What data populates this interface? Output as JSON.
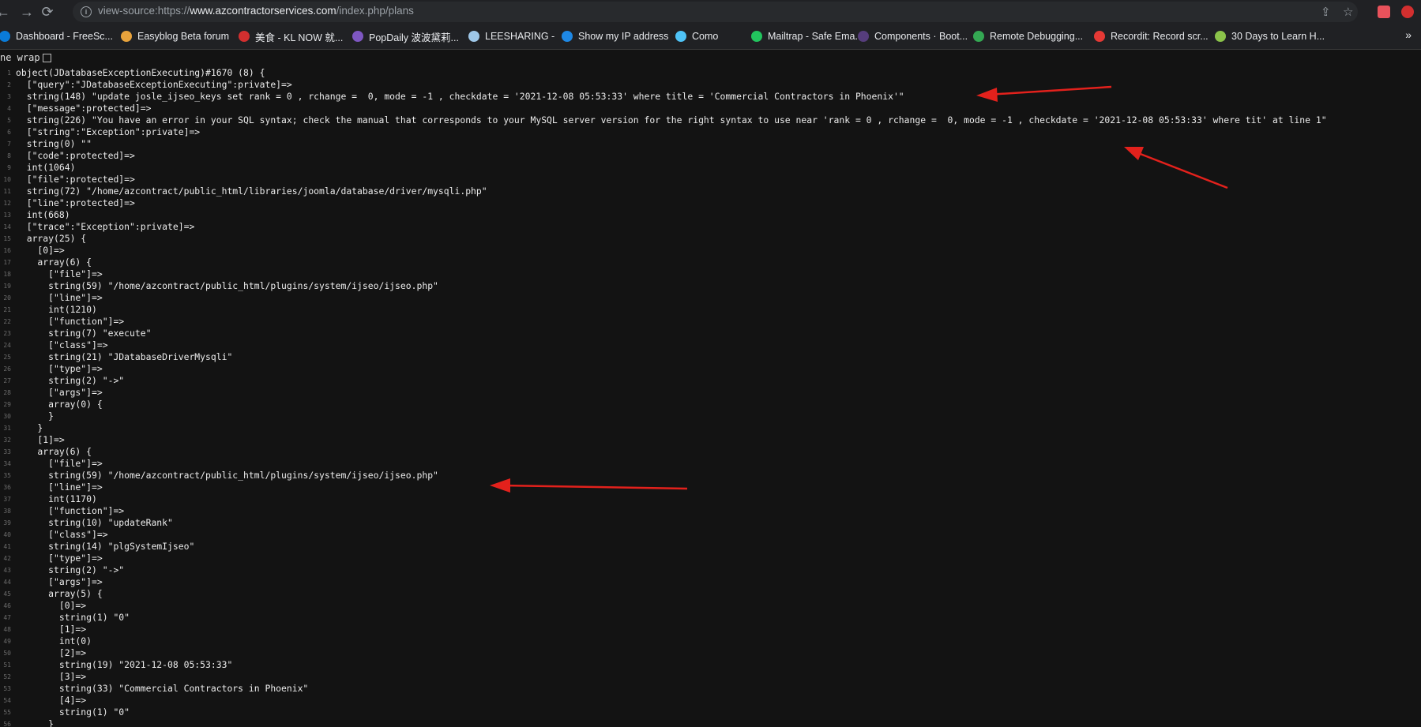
{
  "browser": {
    "url_prefix": "view-source:https://",
    "url_host": "www.azcontractorservices.com",
    "url_path": "/index.php/plans"
  },
  "bookmarks": [
    {
      "label": "Dashboard - FreeSc...",
      "color": "#0a7bd8"
    },
    {
      "label": "Easyblog Beta forum",
      "color": "#e8a33c"
    },
    {
      "label": "美食 - KL NOW 就...",
      "color": "#d32f2f"
    },
    {
      "label": "PopDaily 波波黛莉...",
      "color": "#7e57c2"
    },
    {
      "label": "LEESHARING -",
      "color": "#9ec7e8"
    },
    {
      "label": "Show my IP address",
      "color": "#1e88e5"
    },
    {
      "label": "Como",
      "color": "#4fc3f7"
    },
    {
      "label": "Mailtrap - Safe Ema...",
      "color": "#22c55e"
    },
    {
      "label": "Components · Boot...",
      "color": "#563d7c"
    },
    {
      "label": "Remote Debugging...",
      "color": "#34a853"
    },
    {
      "label": "Recordit: Record scr...",
      "color": "#e53935"
    },
    {
      "label": "30 Days to Learn H...",
      "color": "#8bc34a"
    }
  ],
  "bookmarks_more": "»",
  "line_wrap_label": "ne wrap",
  "code_lines": [
    "object(JDatabaseExceptionExecuting)#1670 (8) {",
    "  [\"query\":\"JDatabaseExceptionExecuting\":private]=>",
    "  string(148) \"update josle_ijseo_keys set rank = 0 , rchange =  0, mode = -1 , checkdate = '2021-12-08 05:53:33' where title = 'Commercial Contractors in Phoenix'\"",
    "  [\"message\":protected]=>",
    "  string(226) \"You have an error in your SQL syntax; check the manual that corresponds to your MySQL server version for the right syntax to use near 'rank = 0 , rchange =  0, mode = -1 , checkdate = '2021-12-08 05:53:33' where tit' at line 1\"",
    "  [\"string\":\"Exception\":private]=>",
    "  string(0) \"\"",
    "  [\"code\":protected]=>",
    "  int(1064)",
    "  [\"file\":protected]=>",
    "  string(72) \"/home/azcontract/public_html/libraries/joomla/database/driver/mysqli.php\"",
    "  [\"line\":protected]=>",
    "  int(668)",
    "  [\"trace\":\"Exception\":private]=>",
    "  array(25) {",
    "    [0]=>",
    "    array(6) {",
    "      [\"file\"]=>",
    "      string(59) \"/home/azcontract/public_html/plugins/system/ijseo/ijseo.php\"",
    "      [\"line\"]=>",
    "      int(1210)",
    "      [\"function\"]=>",
    "      string(7) \"execute\"",
    "      [\"class\"]=>",
    "      string(21) \"JDatabaseDriverMysqli\"",
    "      [\"type\"]=>",
    "      string(2) \"->\"",
    "      [\"args\"]=>",
    "      array(0) {",
    "      }",
    "    }",
    "    [1]=>",
    "    array(6) {",
    "      [\"file\"]=>",
    "      string(59) \"/home/azcontract/public_html/plugins/system/ijseo/ijseo.php\"",
    "      [\"line\"]=>",
    "      int(1170)",
    "      [\"function\"]=>",
    "      string(10) \"updateRank\"",
    "      [\"class\"]=>",
    "      string(14) \"plgSystemIjseo\"",
    "      [\"type\"]=>",
    "      string(2) \"->\"",
    "      [\"args\"]=>",
    "      array(5) {",
    "        [0]=>",
    "        string(1) \"0\"",
    "        [1]=>",
    "        int(0)",
    "        [2]=>",
    "        string(19) \"2021-12-08 05:53:33\"",
    "        [3]=>",
    "        string(33) \"Commercial Contractors in Phoenix\"",
    "        [4]=>",
    "        string(1) \"0\"",
    "      }"
  ],
  "line_numbers": [
    "1",
    "2",
    "3",
    "4",
    "5",
    "6",
    "7",
    "8",
    "9",
    "10",
    "11",
    "12",
    "13",
    "14",
    "15",
    "16",
    "17",
    "18",
    "19",
    "20",
    "21",
    "22",
    "23",
    "24",
    "25",
    "26",
    "27",
    "28",
    "29",
    "30",
    "31",
    "32",
    "33",
    "34",
    "35",
    "36",
    "37",
    "38",
    "39",
    "40",
    "41",
    "42",
    "43",
    "44",
    "45",
    "46",
    "47",
    "48",
    "49",
    "50",
    "51",
    "52",
    "53",
    "54",
    "55",
    "56"
  ],
  "annotation_color": "#e3211c"
}
